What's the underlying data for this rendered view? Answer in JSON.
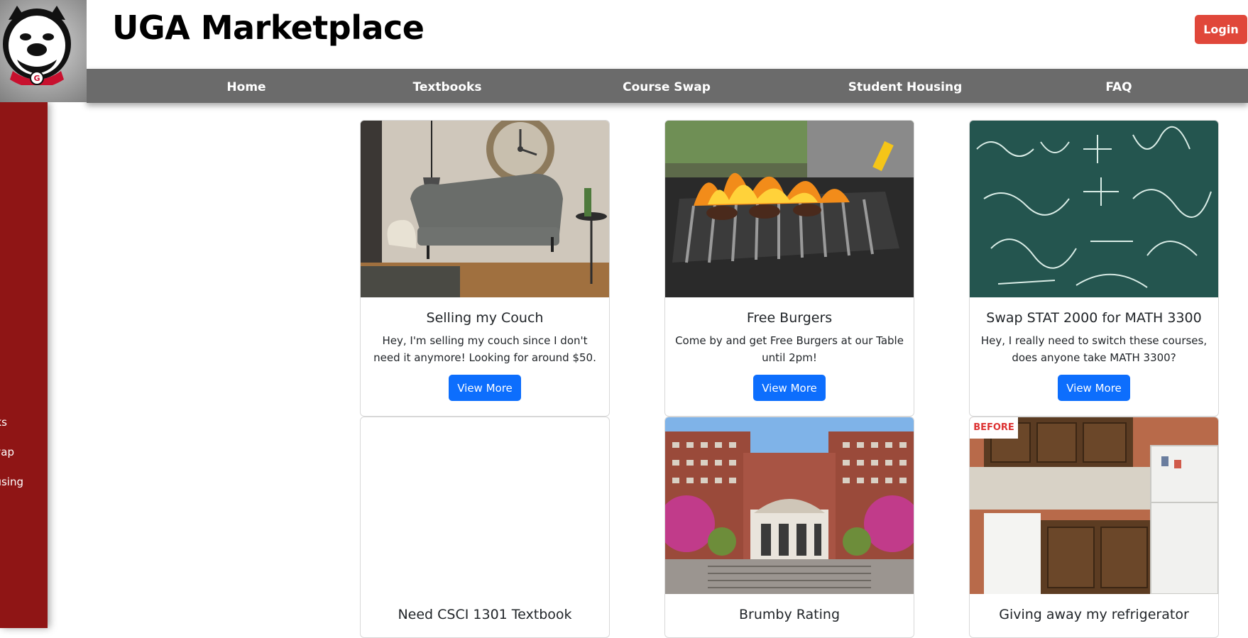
{
  "header": {
    "title": "UGA Marketplace",
    "login_label": "Login"
  },
  "nav": {
    "items": [
      "Home",
      "Textbooks",
      "Course Swap",
      "Student Housing",
      "FAQ"
    ]
  },
  "sidebar": {
    "visible_fragments": [
      "ks",
      "wap",
      "using"
    ]
  },
  "cards": [
    {
      "title": "Selling my Couch",
      "text": "Hey, I'm selling my couch since I don't need it anymore! Looking for around $50.",
      "button": "View More"
    },
    {
      "title": "Free Burgers",
      "text": "Come by and get Free Burgers at our Table until 2pm!",
      "button": "View More"
    },
    {
      "title": "Swap STAT 2000 for MATH 3300",
      "text": "Hey, I really need to switch these courses, does anyone take MATH 3300?",
      "button": "View More"
    },
    {
      "title": "Need CSCI 1301 Textbook"
    },
    {
      "title": "Brumby Rating"
    },
    {
      "title": "Giving away my refrigerator",
      "image_tag": "BEFORE"
    }
  ],
  "colors": {
    "nav_bg": "#6b6b6b",
    "sidebar_bg": "#8f1515",
    "login_bg": "#e0473a",
    "button_bg": "#0d6efd"
  }
}
